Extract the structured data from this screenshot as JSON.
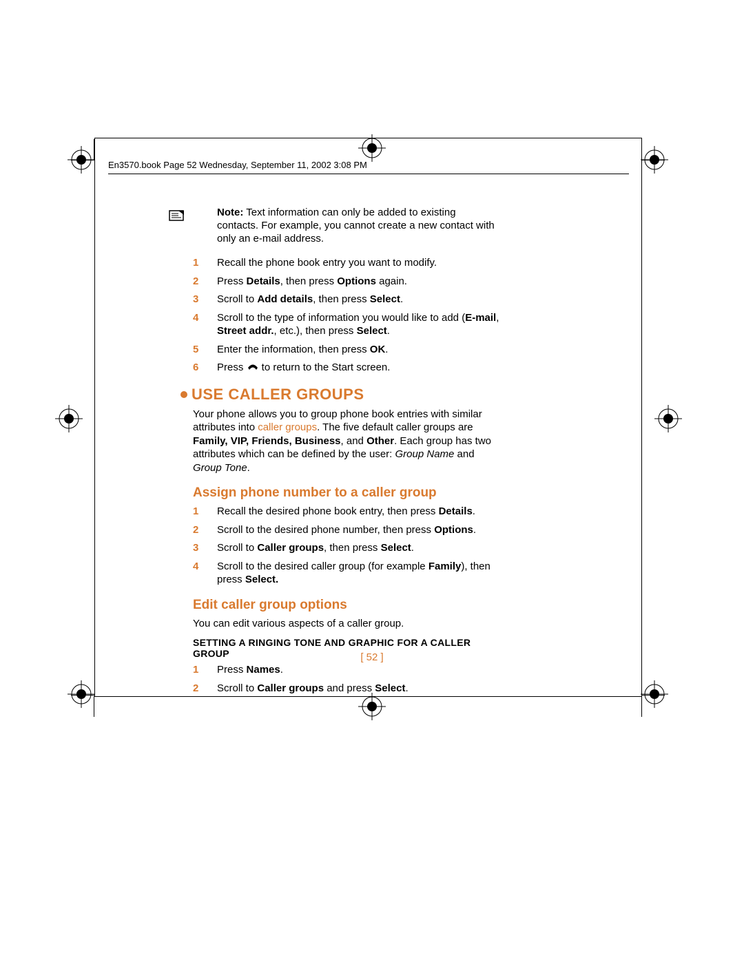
{
  "header": "En3570.book  Page 52  Wednesday, September 11, 2002  3:08 PM",
  "note": {
    "label": "Note:",
    "text_a": " Text information can only be added to existing contacts. For example, you cannot create a new contact with only an e-mail address."
  },
  "top_steps": [
    {
      "n": "1",
      "pre": "Recall the phone book entry you want to modify."
    },
    {
      "n": "2",
      "pre": "Press ",
      "b1": "Details",
      "mid": ", then press ",
      "b2": "Options",
      "post": " again."
    },
    {
      "n": "3",
      "pre": "Scroll to ",
      "b1": "Add details",
      "mid": ", then press ",
      "b2": "Select",
      "post": "."
    },
    {
      "n": "4",
      "pre": "Scroll to the type of information you would like to add (",
      "b1": "E-mail",
      "mid": ", ",
      "b2": "Street addr.",
      "post": ", etc.), then press ",
      "b3": "Select",
      "post2": "."
    },
    {
      "n": "5",
      "pre": "Enter the information, then press ",
      "b1": "OK",
      "post": "."
    },
    {
      "n": "6",
      "pre": "Press   ",
      "post": "   to return to the Start screen."
    }
  ],
  "h1": "USE CALLER GROUPS",
  "intro": {
    "a": "Your phone allows you to group phone book entries with similar attributes into ",
    "link": "caller groups",
    "b": ". The five default caller groups are ",
    "b1": "Family, VIP, Friends, Business",
    "c": ", and ",
    "b2": "Other",
    "d": ". Each group has two attributes which can be defined by the user: ",
    "i1": "Group Name",
    "e": " and ",
    "i2": "Group Tone",
    "f": "."
  },
  "h2a": "Assign phone number to a caller group",
  "assign_steps": [
    {
      "n": "1",
      "pre": "Recall the desired phone book entry, then press ",
      "b1": "Details",
      "post": "."
    },
    {
      "n": "2",
      "pre": "Scroll to the desired phone number, then press ",
      "b1": "Options",
      "post": "."
    },
    {
      "n": "3",
      "pre": "Scroll to ",
      "b1": "Caller groups",
      "mid": ", then press ",
      "b2": "Select",
      "post": "."
    },
    {
      "n": "4",
      "pre": "Scroll to the desired caller group (for example ",
      "b1": "Family",
      "mid": "), then press ",
      "b2": "Select.",
      "post": ""
    }
  ],
  "h2b": "Edit caller group options",
  "edit_intro": "You can edit various aspects of a caller group.",
  "h3": "SETTING A RINGING TONE AND GRAPHIC FOR A CALLER GROUP",
  "edit_steps": [
    {
      "n": "1",
      "pre": "Press ",
      "b1": "Names",
      "post": "."
    },
    {
      "n": "2",
      "pre": "Scroll to ",
      "b1": "Caller groups",
      "mid": " and press ",
      "b2": "Select",
      "post": "."
    }
  ],
  "page_num": "[ 52 ]"
}
